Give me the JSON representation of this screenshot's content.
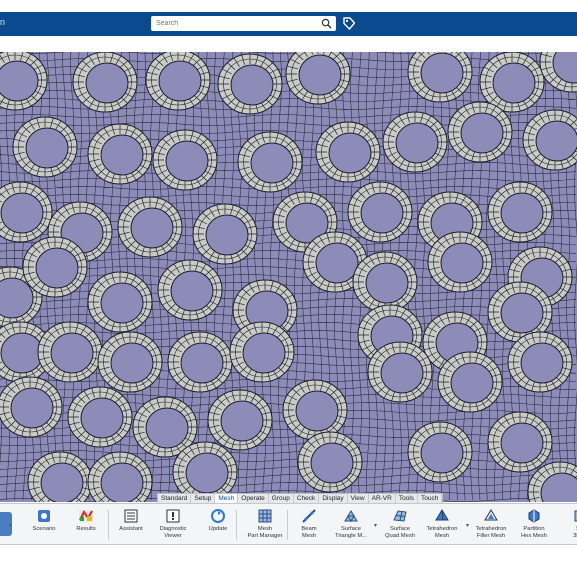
{
  "header": {
    "title_fragment": "n",
    "search_placeholder": "Search",
    "brand_color": "#0b4a8f"
  },
  "icons": {
    "search": "search-icon",
    "tag": "tag-icon"
  },
  "tabs": [
    {
      "label": "Standard",
      "active": false
    },
    {
      "label": "Setup",
      "active": false
    },
    {
      "label": "Mesh",
      "active": true
    },
    {
      "label": "Operate",
      "active": false
    },
    {
      "label": "Group",
      "active": false
    },
    {
      "label": "Check",
      "active": false
    },
    {
      "label": "Display",
      "active": false
    },
    {
      "label": "View",
      "active": false
    },
    {
      "label": "AR-VR",
      "active": false
    },
    {
      "label": "Tools",
      "active": false
    },
    {
      "label": "Touch",
      "active": false
    }
  ],
  "tools": [
    {
      "line1": "Scenario",
      "line2": "",
      "icon": "scenario-icon"
    },
    {
      "line1": "Results",
      "line2": "",
      "icon": "results-icon"
    },
    {
      "line1": "Assistant",
      "line2": "",
      "icon": "assistant-icon"
    },
    {
      "line1": "Diagnostic",
      "line2": "Viewer",
      "icon": "diagnostic-viewer-icon"
    },
    {
      "line1": "Update",
      "line2": "",
      "icon": "update-icon"
    },
    {
      "line1": "Mesh",
      "line2": "Part Manager",
      "icon": "mesh-part-manager-icon"
    },
    {
      "line1": "Beam",
      "line2": "Mesh",
      "icon": "beam-mesh-icon"
    },
    {
      "line1": "Surface",
      "line2": "Triangle M...",
      "icon": "surface-triangle-mesh-icon"
    },
    {
      "line1": "Surface",
      "line2": "Quad Mesh",
      "icon": "surface-quad-mesh-icon"
    },
    {
      "line1": "Tetrahedron",
      "line2": "Mesh",
      "icon": "tetrahedron-mesh-icon"
    },
    {
      "line1": "Tetrahedron",
      "line2": "Filler Mesh",
      "icon": "tetrahedron-filler-mesh-icon"
    },
    {
      "line1": "Partition",
      "line2": "Hex Mesh",
      "icon": "partition-hex-mesh-icon"
    },
    {
      "line1": "Sw",
      "line2": "3D M",
      "icon": "sweep-3d-mesh-icon"
    }
  ],
  "colors": {
    "mesh_fill": "#8d8cb8",
    "ring_fill": "#c9cbc4",
    "wire": "#1c1c2e"
  }
}
